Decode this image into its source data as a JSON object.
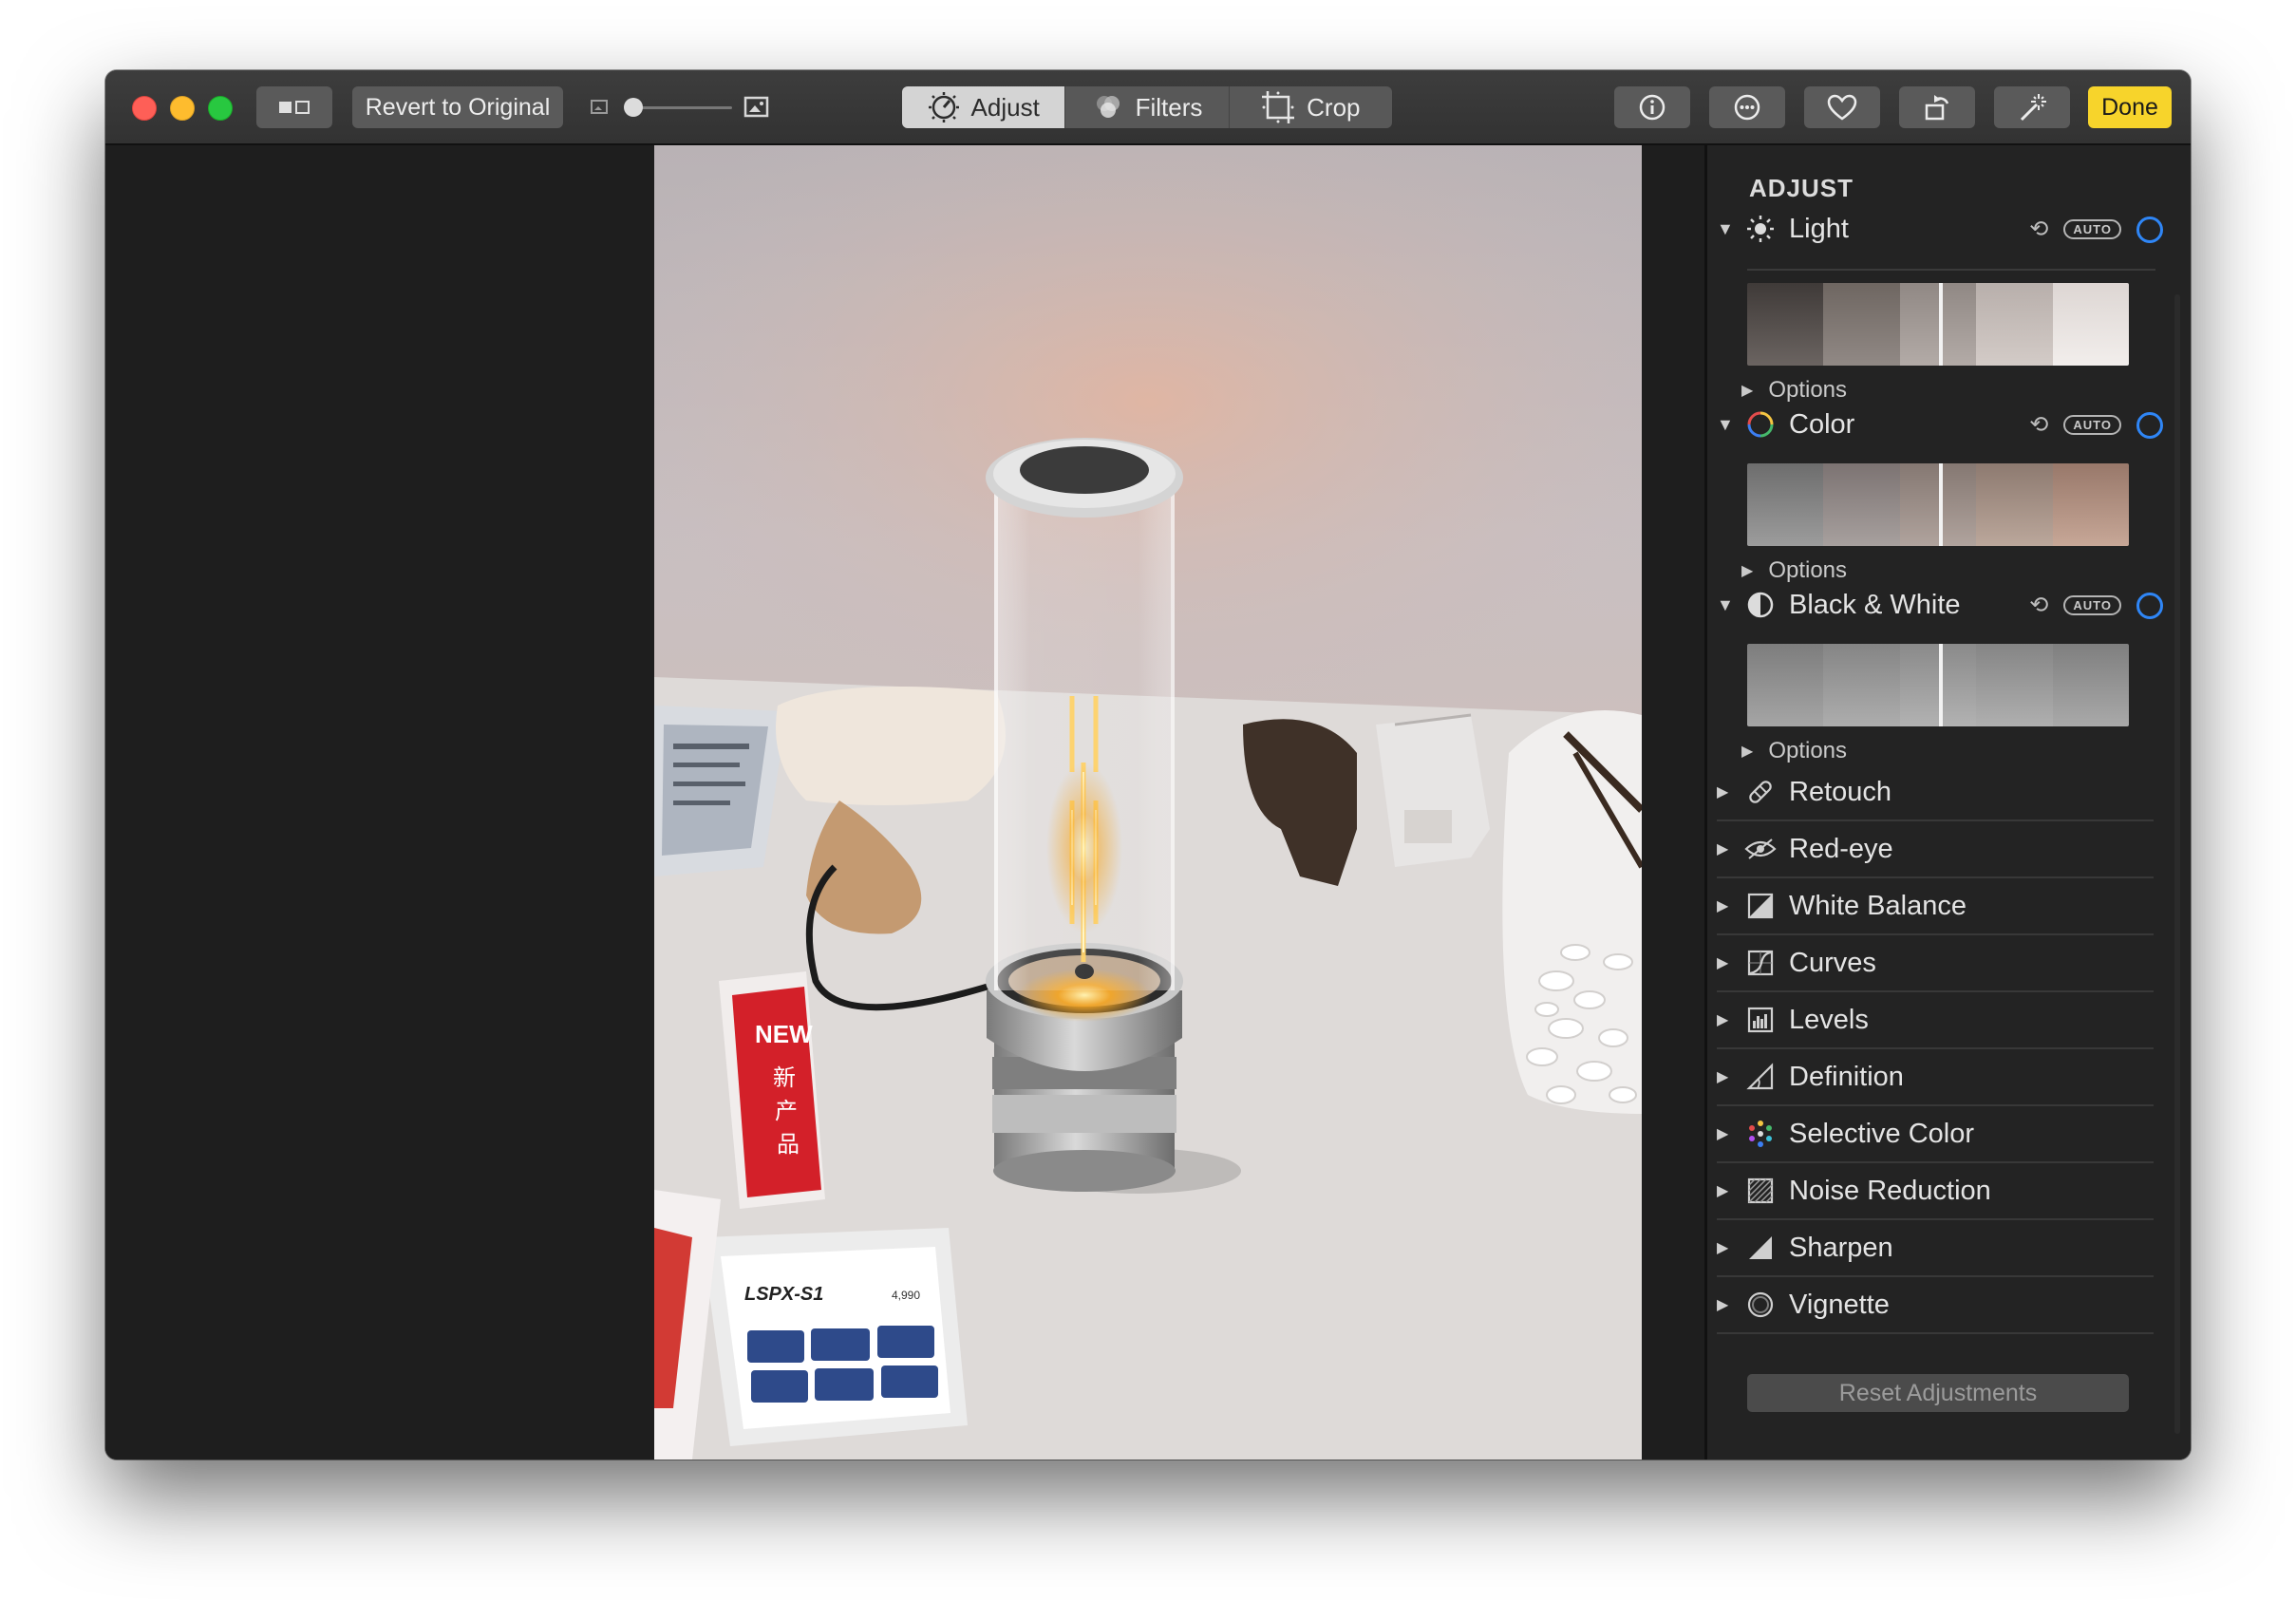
{
  "toolbar": {
    "revert_label": "Revert to Original",
    "tabs": [
      {
        "label": "Adjust",
        "icon": "adjust-dial-icon",
        "active": true
      },
      {
        "label": "Filters",
        "icon": "filters-icon",
        "active": false
      },
      {
        "label": "Crop",
        "icon": "crop-icon",
        "active": false
      }
    ],
    "done_label": "Done",
    "icons": [
      "info-icon",
      "more-icon",
      "heart-icon",
      "rotate-icon",
      "magic-wand-icon"
    ]
  },
  "photo": {
    "sign_new": "NEW",
    "sign_chinese": [
      "新",
      "产",
      "品"
    ],
    "card_model": "LSPX-S1",
    "card_price": "4,990"
  },
  "sidebar": {
    "title": "ADJUST",
    "auto_label": "AUTO",
    "options_label": "Options",
    "sections": [
      {
        "label": "Light",
        "icon": "sun-icon"
      },
      {
        "label": "Color",
        "icon": "color-ring-icon"
      },
      {
        "label": "Black & White",
        "icon": "half-circle-icon"
      }
    ],
    "tools": [
      {
        "label": "Retouch",
        "icon": "bandage-icon"
      },
      {
        "label": "Red-eye",
        "icon": "eye-icon"
      },
      {
        "label": "White Balance",
        "icon": "white-balance-icon"
      },
      {
        "label": "Curves",
        "icon": "curves-icon"
      },
      {
        "label": "Levels",
        "icon": "levels-icon"
      },
      {
        "label": "Definition",
        "icon": "definition-icon"
      },
      {
        "label": "Selective Color",
        "icon": "selective-color-icon"
      },
      {
        "label": "Noise Reduction",
        "icon": "noise-reduction-icon"
      },
      {
        "label": "Sharpen",
        "icon": "sharpen-icon"
      },
      {
        "label": "Vignette",
        "icon": "vignette-icon"
      }
    ],
    "reset_label": "Reset Adjustments"
  },
  "colors": {
    "accent_blue": "#2f86f6",
    "done_yellow": "#f7d42b",
    "toolbar_bg": "#353535",
    "sidebar_bg": "#232323"
  }
}
